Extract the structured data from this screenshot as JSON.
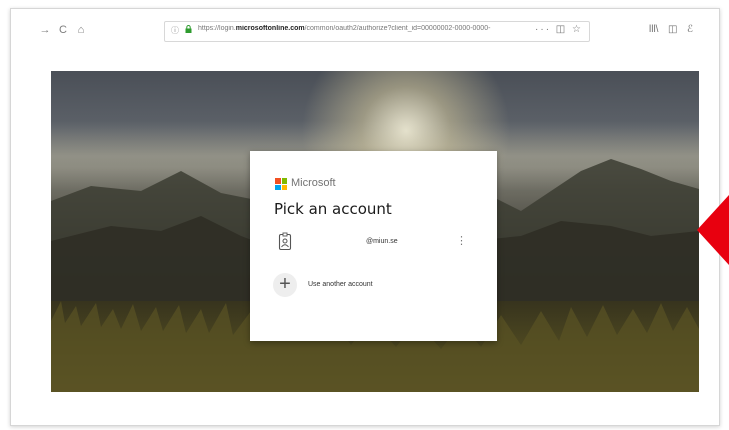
{
  "browser": {
    "nav": {
      "back": "→",
      "reload": "C",
      "home": "⌂"
    },
    "url_info": "ⓘ",
    "url_prefix": "https://login.",
    "url_domain": "microsoftonline.com",
    "url_path": "/common/oauth2/authorize?client_id=00000002-0000-0000-",
    "url_tools": "··· ◫ ☆",
    "tools": {
      "library": "lll\\",
      "sidebar": "◫",
      "extension": "ℰ"
    }
  },
  "login": {
    "brand": "Microsoft",
    "title": "Pick an account",
    "account_email": "@miun.se",
    "more_options": "⋮",
    "other_account_label": "Use another account",
    "plus_glyph": "+"
  },
  "colors": {
    "accent_red": "#e8000f",
    "logo_red": "#f25022",
    "logo_green": "#7fba00",
    "logo_blue": "#00a4ef",
    "logo_yellow": "#ffb900"
  },
  "icons": [
    "back-icon",
    "reload-icon",
    "home-icon",
    "lock-icon",
    "account-icon",
    "plus-icon",
    "red-arrow"
  ]
}
